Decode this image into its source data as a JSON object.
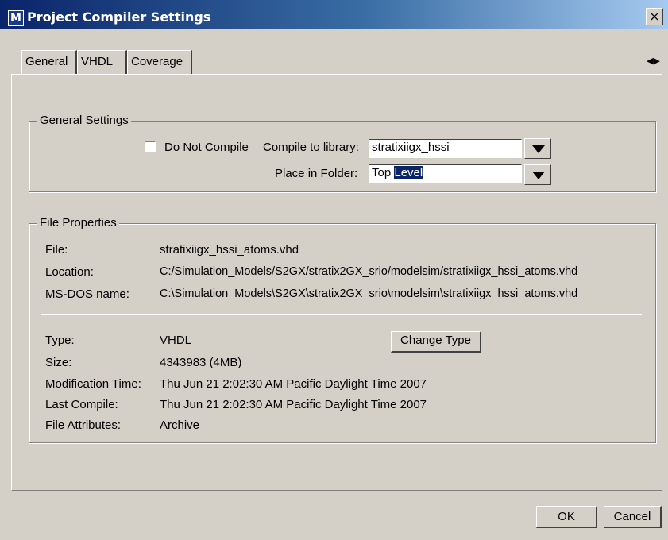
{
  "window": {
    "logo_letter": "M",
    "title": "Project Compiler Settings",
    "close_label": "×"
  },
  "tabs": [
    {
      "label": "General",
      "selected": true
    },
    {
      "label": "VHDL",
      "selected": false
    },
    {
      "label": "Coverage",
      "selected": false
    }
  ],
  "tab_scroll": "◀▶",
  "general_settings": {
    "group_label": "General Settings",
    "do_not_compile_label": "Do Not Compile",
    "do_not_compile_checked": false,
    "compile_to_library_label": "Compile to library:",
    "library_value": "stratixiigx_hssi",
    "place_in_folder_label": "Place in Folder:",
    "folder_value_plain": "Top ",
    "folder_value_selected": "Level"
  },
  "file_properties": {
    "group_label": "File Properties",
    "file_label": "File:",
    "file_value": "stratixiigx_hssi_atoms.vhd",
    "location_label": "Location:",
    "location_value": "C:/Simulation_Models/S2GX/stratix2GX_srio/modelsim/stratixiigx_hssi_atoms.vhd",
    "msdos_label": "MS-DOS name:",
    "msdos_value": "C:\\Simulation_Models\\S2GX\\stratix2GX_srio\\modelsim\\stratixiigx_hssi_atoms.vhd",
    "type_label": "Type:",
    "type_value": "VHDL",
    "change_type_label": "Change Type",
    "size_label": "Size:",
    "size_value": "4343983 (4MB)",
    "modification_label": "Modification Time:",
    "modification_value": "Thu Jun 21 2:02:30 AM Pacific Daylight Time 2007",
    "last_compile_label": "Last Compile:",
    "last_compile_value": "Thu Jun 21 2:02:30 AM Pacific Daylight Time 2007",
    "attributes_label": "File Attributes:",
    "attributes_value": "Archive"
  },
  "footer": {
    "ok_label": "OK",
    "cancel_label": "Cancel"
  },
  "colors": {
    "titlebar": "#0a246a",
    "dialog_face": "#d4d0c8",
    "selection": "#0a246a"
  }
}
